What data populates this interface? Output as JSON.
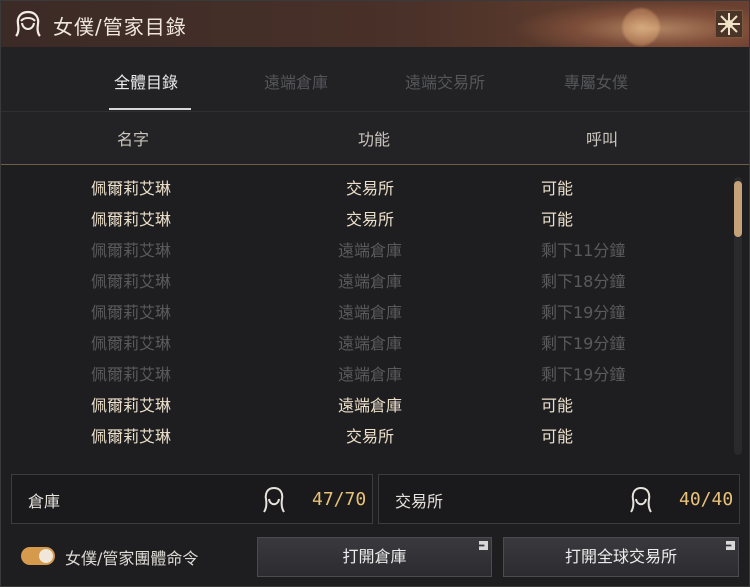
{
  "window": {
    "title": "女僕/管家目錄"
  },
  "tabs": [
    {
      "label": "全體目錄"
    },
    {
      "label": "遠端倉庫"
    },
    {
      "label": "遠端交易所"
    },
    {
      "label": "專屬女僕"
    }
  ],
  "columns": {
    "name": "名字",
    "function": "功能",
    "call": "呼叫"
  },
  "rows": [
    {
      "name": "佩爾莉艾琳",
      "function": "交易所",
      "call": "可能",
      "available": true
    },
    {
      "name": "佩爾莉艾琳",
      "function": "交易所",
      "call": "可能",
      "available": true
    },
    {
      "name": "佩爾莉艾琳",
      "function": "遠端倉庫",
      "call": "剩下11分鐘",
      "available": false
    },
    {
      "name": "佩爾莉艾琳",
      "function": "遠端倉庫",
      "call": "剩下18分鐘",
      "available": false
    },
    {
      "name": "佩爾莉艾琳",
      "function": "遠端倉庫",
      "call": "剩下19分鐘",
      "available": false
    },
    {
      "name": "佩爾莉艾琳",
      "function": "遠端倉庫",
      "call": "剩下19分鐘",
      "available": false
    },
    {
      "name": "佩爾莉艾琳",
      "function": "遠端倉庫",
      "call": "剩下19分鐘",
      "available": false
    },
    {
      "name": "佩爾莉艾琳",
      "function": "遠端倉庫",
      "call": "可能",
      "available": true
    },
    {
      "name": "佩爾莉艾琳",
      "function": "交易所",
      "call": "可能",
      "available": true
    }
  ],
  "summary": {
    "warehouse": {
      "label": "倉庫",
      "count": "47/70"
    },
    "market": {
      "label": "交易所",
      "count": "40/40"
    }
  },
  "footer": {
    "toggle_label": "女僕/管家團體命令",
    "toggle_on": true,
    "open_warehouse": "打開倉庫",
    "open_market": "打開全球交易所"
  },
  "colors": {
    "accent": "#d69a4c",
    "count": "#e8c178",
    "row_active": "#ecdfca",
    "row_inactive": "#5a5a5c"
  },
  "icons": {
    "title": "maid-head-icon",
    "close": "sun-emblem-icon",
    "external": "external-link-icon"
  }
}
